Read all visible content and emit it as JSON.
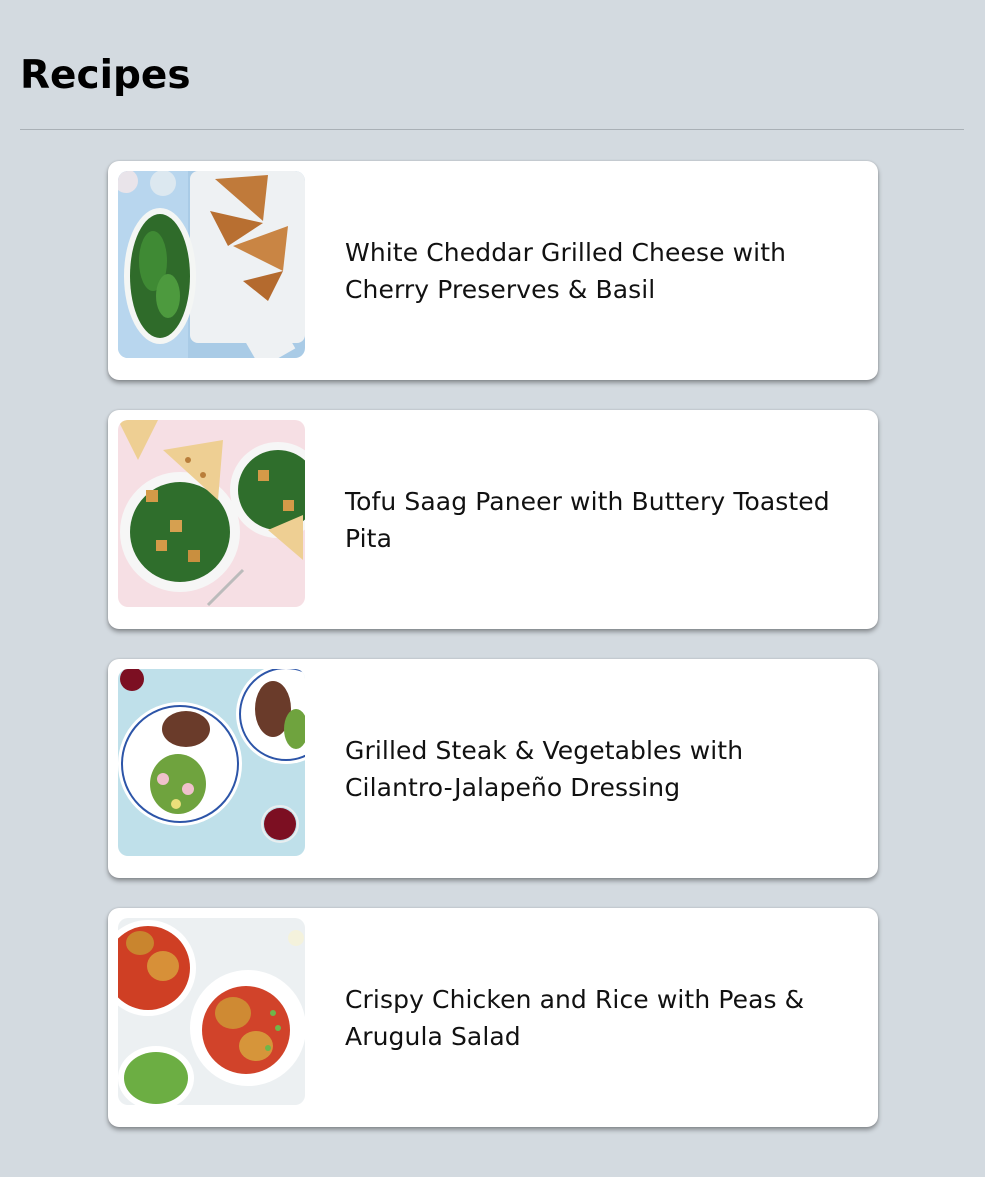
{
  "header": {
    "title": "Recipes"
  },
  "recipes": [
    {
      "title": "White Cheddar Grilled Cheese with Cherry Preserves & Basil",
      "image": "grilled-cheese-photo"
    },
    {
      "title": "Tofu Saag Paneer with Buttery Toasted Pita",
      "image": "saag-paneer-photo"
    },
    {
      "title": "Grilled Steak & Vegetables with Cilantro-Jalapeño Dressing",
      "image": "steak-vegetables-photo"
    },
    {
      "title": "Crispy Chicken and Rice with Peas & Arugula Salad",
      "image": "chicken-rice-photo"
    }
  ],
  "colors": {
    "background": "#d3dae0",
    "card": "#ffffff",
    "divider": "#a9b0b6"
  }
}
